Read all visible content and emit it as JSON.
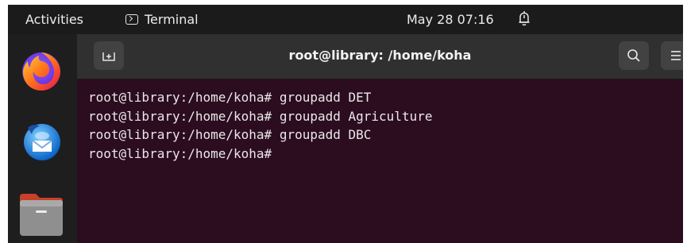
{
  "topbar": {
    "activities": "Activities",
    "app_name": "Terminal",
    "clock": "May 28  07:16"
  },
  "dock": {
    "apps": [
      {
        "icon": "firefox-icon"
      },
      {
        "icon": "thunderbird-icon"
      },
      {
        "icon": "files-icon"
      }
    ]
  },
  "terminal": {
    "title": "root@library: /home/koha",
    "lines": [
      "root@library:/home/koha# groupadd DET",
      "root@library:/home/koha# groupadd Agriculture",
      "root@library:/home/koha# groupadd DBC",
      "root@library:/home/koha#"
    ]
  },
  "colors": {
    "terminal_bg": "#2c0c1f",
    "headerbar_bg": "#303030",
    "topbar_bg": "#1b1b1b",
    "dock_bg": "#1e1e1e"
  }
}
